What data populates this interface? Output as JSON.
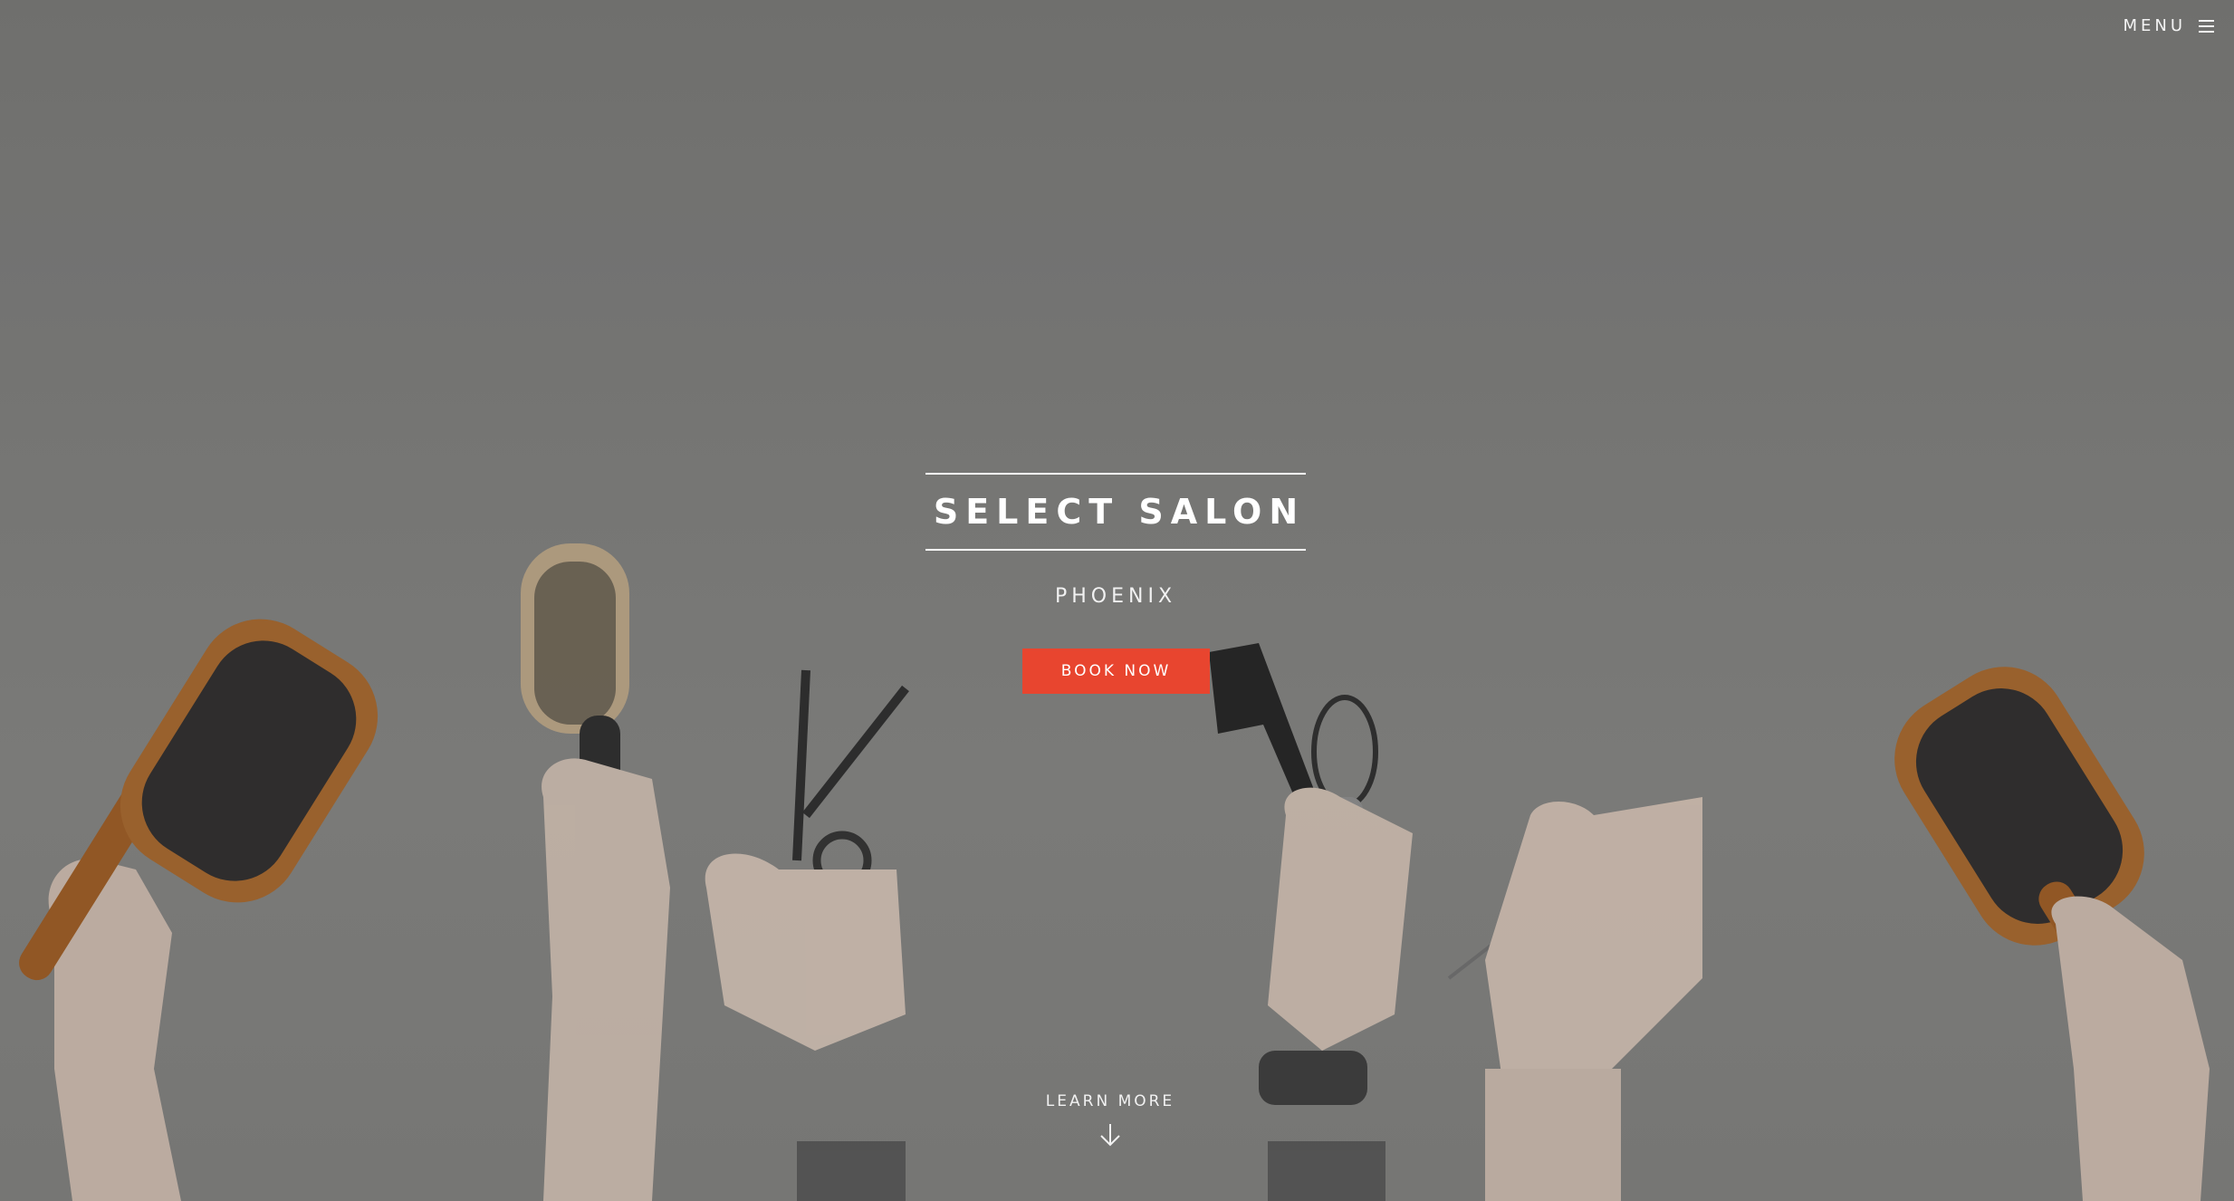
{
  "header": {
    "menu_label": "MENU",
    "menu_icon": "hamburger-icon"
  },
  "hero": {
    "title": "SELECT SALON",
    "subtitle": "PHOENIX",
    "cta_label": "BOOK NOW",
    "learn_more_label": "LEARN MORE",
    "learn_more_icon": "arrow-down-icon"
  },
  "colors": {
    "accent": "#e8452f",
    "background": "#7a7a78",
    "text": "#ffffff"
  }
}
